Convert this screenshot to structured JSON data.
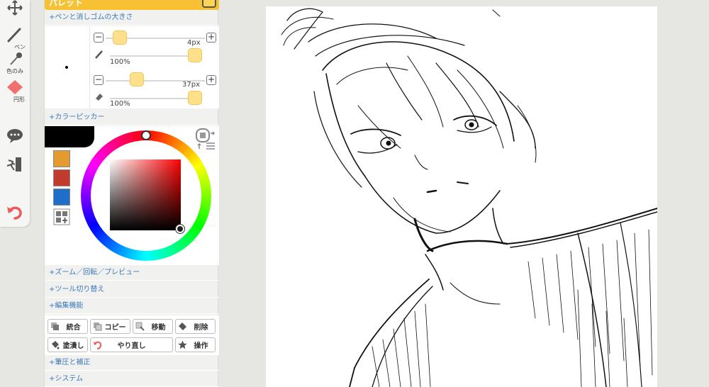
{
  "toolbar": {
    "pen_label": "ペン",
    "eyedropper_label": "色のみ",
    "shape_label": "円形"
  },
  "palette": {
    "title": "パレット",
    "sections": {
      "brush_size": "+ペンと消しゴムの大きさ",
      "color_picker": "+カラーピッカー",
      "zoom": "+ズーム／回転／プレビュー",
      "tool_switch": "+ツール切り替え",
      "edit": "+編集機能",
      "pressure": "+筆圧と補正",
      "system": "+システム"
    },
    "pen": {
      "size": "4px",
      "opacity": "100%"
    },
    "eraser": {
      "size": "37px",
      "opacity": "100%"
    },
    "colors": {
      "current": "#000000",
      "swatches": [
        "#e39a2e",
        "#c23b2f",
        "#1f6fc8"
      ],
      "hue_handle": "red"
    },
    "actions": {
      "merge": "統合",
      "copy": "コピー",
      "move": "移動",
      "delete": "削除",
      "fill": "塗潰し",
      "redo": "やり直し",
      "operate": "操作"
    }
  }
}
